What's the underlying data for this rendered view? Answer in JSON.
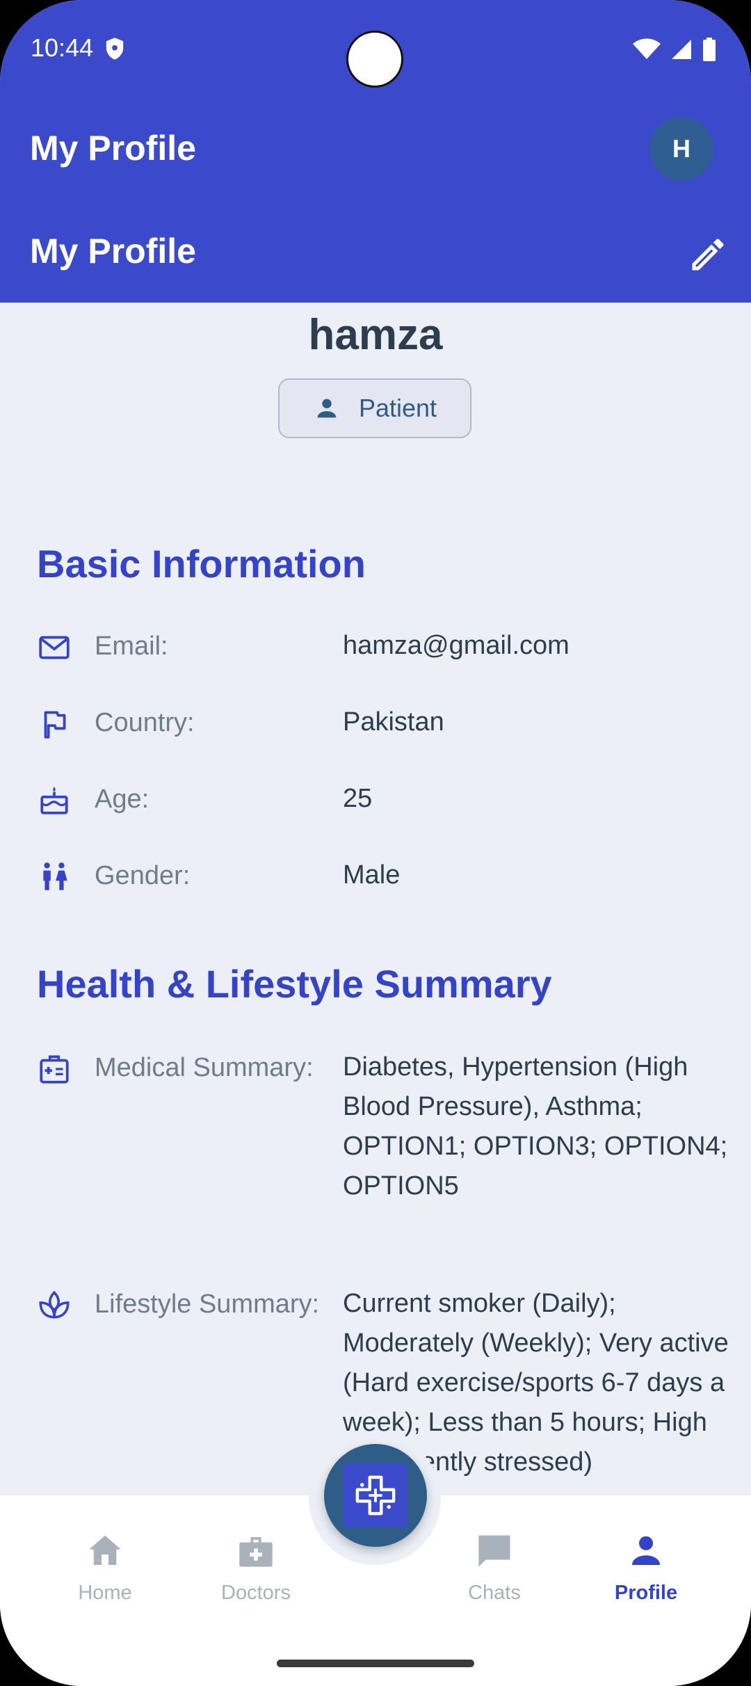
{
  "status_bar": {
    "time": "10:44"
  },
  "app_bar": {
    "title": "My Profile",
    "avatar_initial": "H"
  },
  "section_bar": {
    "title": "My Profile"
  },
  "profile": {
    "username": "hamza",
    "role": "Patient"
  },
  "basic_info": {
    "heading": "Basic Information",
    "rows": [
      {
        "label": "Email:",
        "value": "hamza@gmail.com",
        "icon": "mail-icon"
      },
      {
        "label": "Country:",
        "value": "Pakistan",
        "icon": "flag-icon"
      },
      {
        "label": "Age:",
        "value": "25",
        "icon": "cake-icon"
      },
      {
        "label": "Gender:",
        "value": "Male",
        "icon": "gender-icon"
      }
    ]
  },
  "health": {
    "heading": "Health & Lifestyle Summary",
    "rows": [
      {
        "label": "Medical Summary:",
        "value": "Diabetes, Hypertension (High Blood Pressure), Asthma; OPTION1; OPTION3; OPTION4; OPTION5",
        "icon": "medical-card-icon"
      },
      {
        "label": "Lifestyle Summary:",
        "value": "Current smoker (Daily); Moderately (Weekly); Very active (Hard exercise/sports 6-7 days a week); Less than 5 hours; High (Frequently stressed)",
        "icon": "spa-icon"
      }
    ]
  },
  "bottom_nav": {
    "items": [
      {
        "label": "Home",
        "icon": "home-icon"
      },
      {
        "label": "Doctors",
        "icon": "medical-bag-icon"
      },
      {
        "label": "Chats",
        "icon": "chat-icon"
      },
      {
        "label": "Profile",
        "icon": "person-icon"
      }
    ],
    "active": "Profile"
  },
  "colors": {
    "primary": "#3B4ACB",
    "heading": "#3443C8",
    "text": "#2C3D4E",
    "muted": "#6F7C8A",
    "background": "#ECF0F6"
  }
}
